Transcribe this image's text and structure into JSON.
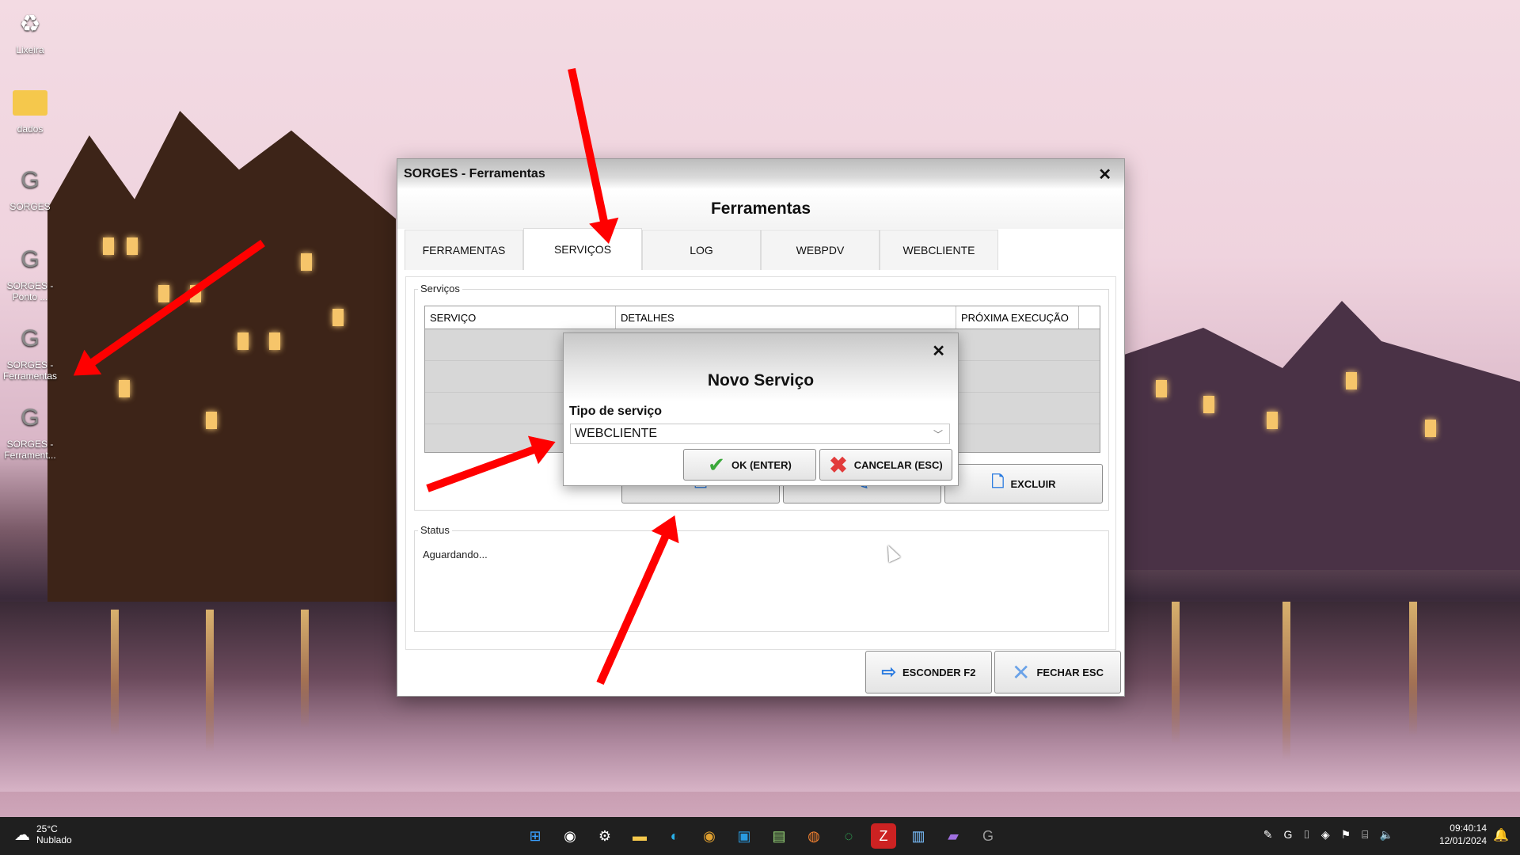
{
  "desktop": {
    "icons": [
      {
        "label": "Lixeira",
        "icon": "recycle-bin-icon"
      },
      {
        "label": "dados",
        "icon": "folder-icon"
      },
      {
        "label": "SORGES",
        "icon": "sorges-app-icon"
      },
      {
        "label": "SORGES - Ponto ...",
        "icon": "sorges-app-icon"
      },
      {
        "label": "SORGES - Ferramentas",
        "icon": "sorges-app-icon"
      },
      {
        "label": "SORGES - Ferrament...",
        "icon": "sorges-app-icon"
      }
    ]
  },
  "window": {
    "title": "SORGES - Ferramentas",
    "header": "Ferramentas",
    "tabs": [
      "FERRAMENTAS",
      "SERVIÇOS",
      "LOG",
      "WEBPDV",
      "WEBCLIENTE"
    ],
    "active_tab": "SERVIÇOS",
    "services_group_label": "Serviços",
    "columns": [
      "SERVIÇO",
      "DETALHES",
      "PRÓXIMA EXECUÇÃO"
    ],
    "delete_button": "EXCLUIR",
    "status_group_label": "Status",
    "status_text": "Aguardando...",
    "hide_button": "ESCONDER F2",
    "close_button": "FECHAR ESC"
  },
  "dialog": {
    "title": "Novo Serviço",
    "field_label": "Tipo de serviço",
    "selected_value": "WEBCLIENTE",
    "ok_button": "OK (ENTER)",
    "cancel_button": "CANCELAR (ESC)"
  },
  "taskbar": {
    "weather_temp": "25°C",
    "weather_desc": "Nublado",
    "time": "09:40:14",
    "date": "12/01/2024",
    "apps": [
      "windows-start-icon",
      "chrome-icon",
      "settings-icon",
      "file-explorer-icon",
      "edge-icon",
      "chrome-icon",
      "store-icon",
      "notepad-icon",
      "firefox-icon",
      "whatsapp-icon",
      "filezilla-icon",
      "notes-icon",
      "video-icon",
      "sorges-taskbar-icon"
    ]
  },
  "colors": {
    "arrow": "#ff0000",
    "taskbar": "#1f1f1f"
  }
}
